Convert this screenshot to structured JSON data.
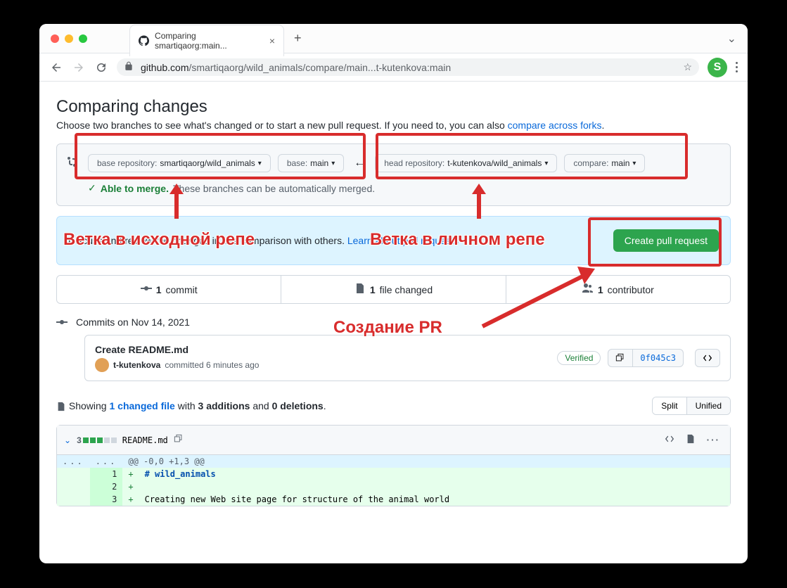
{
  "browser": {
    "tab_title": "Comparing smartiqaorg:main...",
    "url_host": "github.com",
    "url_path": "/smartiqaorg/wild_animals/compare/main...t-kutenkova:main",
    "avatar_letter": "S"
  },
  "page": {
    "heading": "Comparing changes",
    "subheading_prefix": "Choose two branches to see what's changed or to start a new pull request. If you need to, you can also ",
    "subheading_link": "compare across forks",
    "subheading_suffix": "."
  },
  "compare": {
    "base_repo_label": "base repository:",
    "base_repo_value": "smartiqaorg/wild_animals",
    "base_branch_label": "base:",
    "base_branch_value": "main",
    "head_repo_label": "head repository:",
    "head_repo_value": "t-kutenkova/wild_animals",
    "compare_label": "compare:",
    "compare_value": "main",
    "merge_able": "Able to merge.",
    "merge_text": "These branches can be automatically merged."
  },
  "pr_banner": {
    "text_prefix": "Discuss and review the changes in this comparison with others. ",
    "text_link": "Learn about pull requests",
    "button": "Create pull request"
  },
  "stats": {
    "commits_count": "1",
    "commits_label": "commit",
    "files_count": "1",
    "files_label": "file changed",
    "contributors_count": "1",
    "contributors_label": "contributor"
  },
  "commits": {
    "date_header": "Commits on Nov 14, 2021",
    "items": [
      {
        "title": "Create README.md",
        "author": "t-kutenkova",
        "time": "committed 6 minutes ago",
        "verified": "Verified",
        "sha": "0f045c3"
      }
    ]
  },
  "files_summary": {
    "showing": "Showing",
    "files_link": "1 changed file",
    "with": "with",
    "additions": "3 additions",
    "and": "and",
    "deletions": "0 deletions",
    "split": "Split",
    "unified": "Unified"
  },
  "diff": {
    "count": "3",
    "filename": "README.md",
    "hunk": "@@ -0,0 +1,3 @@",
    "lines": [
      {
        "new": "1",
        "content": "# wild_animals",
        "is_heading": true
      },
      {
        "new": "2",
        "content": ""
      },
      {
        "new": "3",
        "content": "Creating new Web site page for structure of the animal world"
      }
    ]
  },
  "annotations": {
    "source_branch": "Ветка в исходной репе",
    "personal_branch": "Ветка в личном репе",
    "create_pr": "Создание PR"
  }
}
